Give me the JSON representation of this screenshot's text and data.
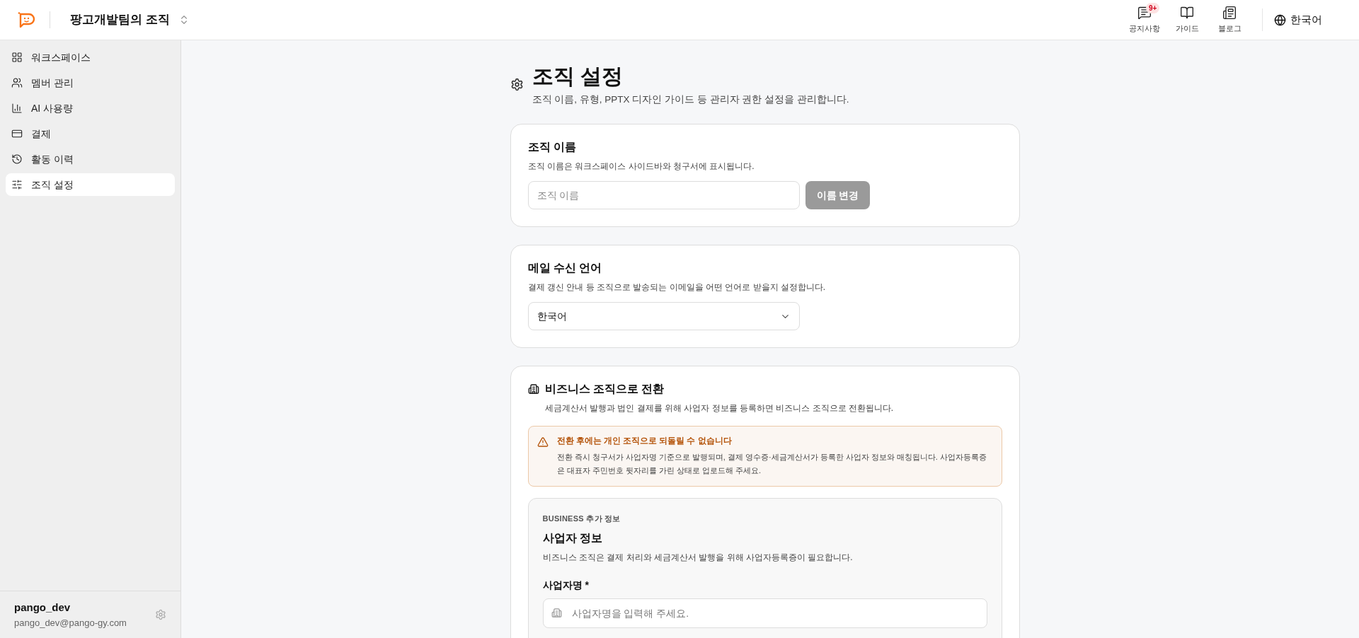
{
  "header": {
    "org_name": "팡고개발팀의 조직",
    "nav": [
      {
        "kind": "notice",
        "label": "공지사항",
        "badge": "9+"
      },
      {
        "kind": "guide",
        "label": "가이드"
      },
      {
        "kind": "blog",
        "label": "블로그"
      }
    ],
    "language": "한국어"
  },
  "sidebar": {
    "items": [
      {
        "kind": "grid",
        "label": "워크스페이스",
        "selected": false
      },
      {
        "kind": "users",
        "label": "멤버 관리",
        "selected": false
      },
      {
        "kind": "chart",
        "label": "AI 사용량",
        "selected": false
      },
      {
        "kind": "card",
        "label": "결제",
        "selected": false
      },
      {
        "kind": "history",
        "label": "활동 이력",
        "selected": false
      },
      {
        "kind": "sliders",
        "label": "조직 설정",
        "selected": true
      }
    ],
    "user": {
      "name": "pango_dev",
      "email": "pango_dev@pango-gy.com"
    }
  },
  "page": {
    "title": "조직 설정",
    "subtitle": "조직 이름, 유형, PPTX 디자인 가이드 등 관리자 권한 설정을 관리합니다."
  },
  "org_name_card": {
    "title": "조직 이름",
    "description": "조직 이름은 워크스페이스 사이드바와 청구서에 표시됩니다.",
    "placeholder": "조직 이름",
    "button": {
      "label": "이름 변경",
      "disabled": true
    }
  },
  "mail_language_card": {
    "title": "메일 수신 언어",
    "description": "결제 갱신 안내 등 조직으로 발송되는 이메일을 어떤 언어로 받을지 설정합니다.",
    "value": "한국어"
  },
  "business_card": {
    "title": "비즈니스 조직으로 전환",
    "description": "세금계산서 발행과 법인 결제를 위해 사업자 정보를 등록하면 비즈니스 조직으로 전환됩니다.",
    "warning": {
      "title": "전환 후에는 개인 조직으로 되돌릴 수 없습니다",
      "body": "전환 즉시 청구서가 사업자명 기준으로 발행되며, 결제 영수증·세금계산서가 등록한 사업자 정보와 매칭됩니다. 사업자등록증은 대표자 주민번호 뒷자리를 가린 상태로 업로드해 주세요."
    },
    "info": {
      "eyebrow": "BUSINESS 추가 정보",
      "title": "사업자 정보",
      "description": "비즈니스 조직은 결제 처리와 세금계산서 발행을 위해 사업자등록증이 필요합니다.",
      "field_label": "사업자명 *",
      "placeholder": "사업자명을 입력해 주세요."
    }
  }
}
